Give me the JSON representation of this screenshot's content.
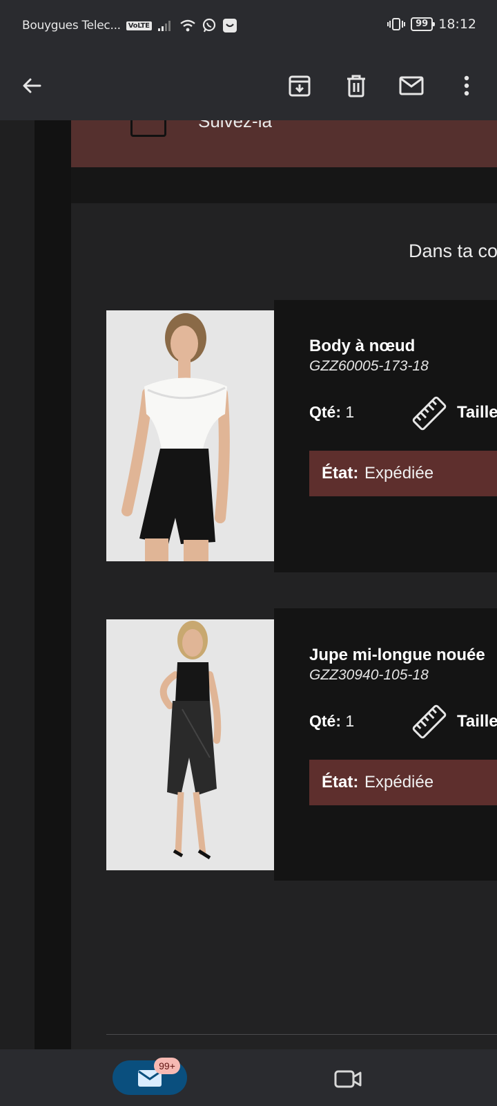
{
  "status_bar": {
    "carrier": "Bouygues Telec...",
    "volte": "VoLTE",
    "battery": "99",
    "time": "18:12"
  },
  "app_bar": {
    "icons": [
      "back-arrow-icon",
      "archive-icon",
      "trash-icon",
      "mail-icon",
      "more-vert-icon"
    ]
  },
  "banner": {
    "text": "Suivez-la"
  },
  "order": {
    "heading": "Dans ta co",
    "products": [
      {
        "name": "Body à nœud",
        "sku": "GZZ60005-173-18",
        "qty_label": "Qté:",
        "qty": "1",
        "size_label": "Taille",
        "state_label": "État:",
        "state": "Expédiée"
      },
      {
        "name": "Jupe mi-longue nouée",
        "sku": "GZZ30940-105-18",
        "qty_label": "Qté:",
        "qty": "1",
        "size_label": "Taille",
        "state_label": "État:",
        "state": "Expédiée"
      }
    ]
  },
  "bottom_nav": {
    "mail_badge": "99+",
    "icons": [
      "mail-icon",
      "video-icon"
    ]
  },
  "colors": {
    "status_bg": "#2a2b2f",
    "banner_bg": "#55302e",
    "state_bg": "#5e2f2d",
    "card_bg": "#141414",
    "badge_bg": "#f6b9b3",
    "nav_pill": "#0a4f7e"
  }
}
